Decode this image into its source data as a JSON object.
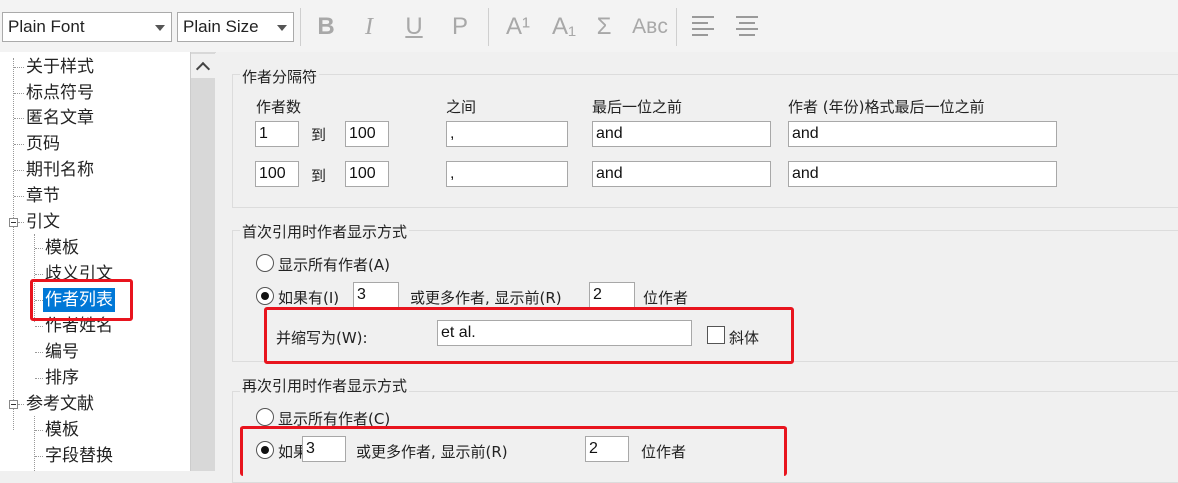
{
  "toolbar": {
    "font_value": "Plain Font",
    "size_value": "Plain Size",
    "bold": "B",
    "italic": "I",
    "underline": "U",
    "plain": "P",
    "superscript": "A¹",
    "subscript": "A₁",
    "symbol": "Σ",
    "small_caps": "Aʙᴄ"
  },
  "tree": {
    "items": [
      "关于样式",
      "标点符号",
      "匿名文章",
      "页码",
      "期刊名称",
      "章节",
      "引文",
      "模板",
      "歧义引文",
      "作者列表",
      "作者姓名",
      "编号",
      "排序",
      "参考文献",
      "模板",
      "字段替换"
    ]
  },
  "separators": {
    "title": "作者分隔符",
    "col_count": "作者数",
    "col_between": "之间",
    "col_before_last": "最后一位之前",
    "col_before_last_year": "作者 (年份)格式最后一位之前",
    "to_label": "到",
    "rows": [
      {
        "from": "1",
        "to": "100",
        "between": ",",
        "before_last": "and",
        "before_last_year": "and"
      },
      {
        "from": "100",
        "to": "100",
        "between": ",",
        "before_last": "and",
        "before_last_year": "and"
      }
    ]
  },
  "first_citation": {
    "title": "首次引用时作者显示方式",
    "show_all": "显示所有作者(A)",
    "if_has": "如果有(I)",
    "min_authors": "3",
    "or_more": "或更多作者, 显示前(R)",
    "show_first": "2",
    "unit": "位作者",
    "abbrev_label": "并缩写为(W):",
    "abbrev_value": "et al.",
    "italic_label": "斜体"
  },
  "subsequent_citation": {
    "title": "再次引用时作者显示方式",
    "show_all": "显示所有作者(C)",
    "if_has": "如果",
    "min_authors": "3",
    "or_more": "或更多作者, 显示前(R)",
    "show_first": "2",
    "unit": "位作者"
  },
  "colors": {
    "highlight": "#e8141e",
    "selection": "#0078d7"
  }
}
